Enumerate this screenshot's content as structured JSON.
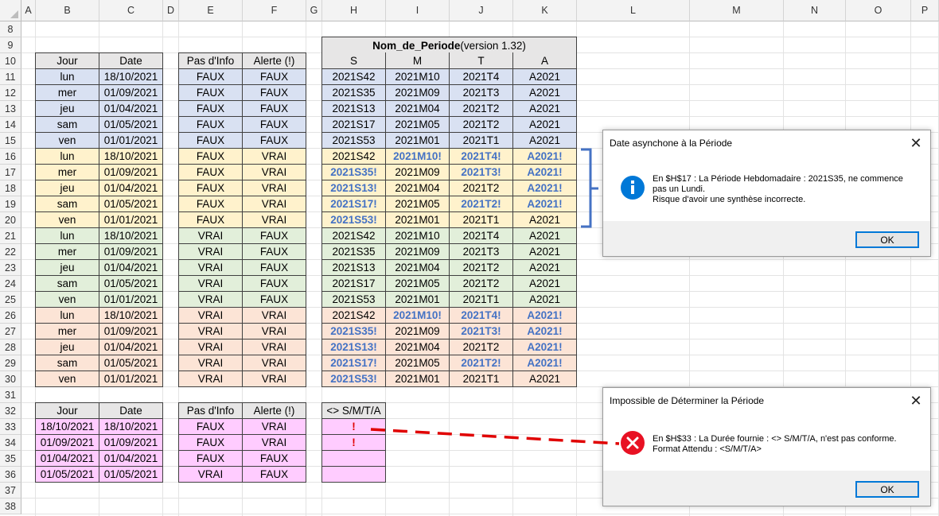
{
  "columns": [
    "A",
    "B",
    "C",
    "D",
    "E",
    "F",
    "G",
    "H",
    "I",
    "J",
    "K",
    "L",
    "M",
    "N",
    "O",
    "P"
  ],
  "rows": [
    "8",
    "9",
    "10",
    "11",
    "12",
    "13",
    "14",
    "15",
    "16",
    "17",
    "18",
    "19",
    "20",
    "21",
    "22",
    "23",
    "24",
    "25",
    "26",
    "27",
    "28",
    "29",
    "30",
    "31",
    "32",
    "33",
    "34",
    "35",
    "36",
    "37",
    "38"
  ],
  "colors": {
    "blue": "#d9e1f2",
    "yellow": "#fff2cc",
    "green": "#e2efda",
    "orange": "#fce4d6",
    "pink": "#ffccff",
    "header": "#e7e6e6",
    "accent": "#4472c4",
    "error": "#e81123"
  },
  "period_title": {
    "bold": "Nom_de_Periode",
    "rest": " (version 1.32)"
  },
  "table1": {
    "headers": {
      "jour": "Jour",
      "date": "Date",
      "pas": "Pas d'Info",
      "alerte": "Alerte (!)",
      "s": "S",
      "m": "M",
      "t": "T",
      "a": "A"
    },
    "rows": [
      {
        "jour": "lun",
        "date": "18/10/2021",
        "pas": "FAUX",
        "alerte": "FAUX",
        "s": "2021S42",
        "m": "2021M10",
        "t": "2021T4",
        "a": "A2021",
        "w": [
          0,
          0,
          0,
          0
        ],
        "fill": "blue"
      },
      {
        "jour": "mer",
        "date": "01/09/2021",
        "pas": "FAUX",
        "alerte": "FAUX",
        "s": "2021S35",
        "m": "2021M09",
        "t": "2021T3",
        "a": "A2021",
        "w": [
          0,
          0,
          0,
          0
        ],
        "fill": "blue"
      },
      {
        "jour": "jeu",
        "date": "01/04/2021",
        "pas": "FAUX",
        "alerte": "FAUX",
        "s": "2021S13",
        "m": "2021M04",
        "t": "2021T2",
        "a": "A2021",
        "w": [
          0,
          0,
          0,
          0
        ],
        "fill": "blue"
      },
      {
        "jour": "sam",
        "date": "01/05/2021",
        "pas": "FAUX",
        "alerte": "FAUX",
        "s": "2021S17",
        "m": "2021M05",
        "t": "2021T2",
        "a": "A2021",
        "w": [
          0,
          0,
          0,
          0
        ],
        "fill": "blue"
      },
      {
        "jour": "ven",
        "date": "01/01/2021",
        "pas": "FAUX",
        "alerte": "FAUX",
        "s": "2021S53",
        "m": "2021M01",
        "t": "2021T1",
        "a": "A2021",
        "w": [
          0,
          0,
          0,
          0
        ],
        "fill": "blue"
      },
      {
        "jour": "lun",
        "date": "18/10/2021",
        "pas": "FAUX",
        "alerte": "VRAI",
        "s": "2021S42",
        "m": "2021M10!",
        "t": "2021T4!",
        "a": "A2021!",
        "w": [
          0,
          1,
          1,
          1
        ],
        "fill": "yellow"
      },
      {
        "jour": "mer",
        "date": "01/09/2021",
        "pas": "FAUX",
        "alerte": "VRAI",
        "s": "2021S35!",
        "m": "2021M09",
        "t": "2021T3!",
        "a": "A2021!",
        "w": [
          1,
          0,
          1,
          1
        ],
        "fill": "yellow"
      },
      {
        "jour": "jeu",
        "date": "01/04/2021",
        "pas": "FAUX",
        "alerte": "VRAI",
        "s": "2021S13!",
        "m": "2021M04",
        "t": "2021T2",
        "a": "A2021!",
        "w": [
          1,
          0,
          0,
          1
        ],
        "fill": "yellow"
      },
      {
        "jour": "sam",
        "date": "01/05/2021",
        "pas": "FAUX",
        "alerte": "VRAI",
        "s": "2021S17!",
        "m": "2021M05",
        "t": "2021T2!",
        "a": "A2021!",
        "w": [
          1,
          0,
          1,
          1
        ],
        "fill": "yellow"
      },
      {
        "jour": "ven",
        "date": "01/01/2021",
        "pas": "FAUX",
        "alerte": "VRAI",
        "s": "2021S53!",
        "m": "2021M01",
        "t": "2021T1",
        "a": "A2021",
        "w": [
          1,
          0,
          0,
          0
        ],
        "fill": "yellow"
      },
      {
        "jour": "lun",
        "date": "18/10/2021",
        "pas": "VRAI",
        "alerte": "FAUX",
        "s": "2021S42",
        "m": "2021M10",
        "t": "2021T4",
        "a": "A2021",
        "w": [
          0,
          0,
          0,
          0
        ],
        "fill": "green"
      },
      {
        "jour": "mer",
        "date": "01/09/2021",
        "pas": "VRAI",
        "alerte": "FAUX",
        "s": "2021S35",
        "m": "2021M09",
        "t": "2021T3",
        "a": "A2021",
        "w": [
          0,
          0,
          0,
          0
        ],
        "fill": "green"
      },
      {
        "jour": "jeu",
        "date": "01/04/2021",
        "pas": "VRAI",
        "alerte": "FAUX",
        "s": "2021S13",
        "m": "2021M04",
        "t": "2021T2",
        "a": "A2021",
        "w": [
          0,
          0,
          0,
          0
        ],
        "fill": "green"
      },
      {
        "jour": "sam",
        "date": "01/05/2021",
        "pas": "VRAI",
        "alerte": "FAUX",
        "s": "2021S17",
        "m": "2021M05",
        "t": "2021T2",
        "a": "A2021",
        "w": [
          0,
          0,
          0,
          0
        ],
        "fill": "green"
      },
      {
        "jour": "ven",
        "date": "01/01/2021",
        "pas": "VRAI",
        "alerte": "FAUX",
        "s": "2021S53",
        "m": "2021M01",
        "t": "2021T1",
        "a": "A2021",
        "w": [
          0,
          0,
          0,
          0
        ],
        "fill": "green"
      },
      {
        "jour": "lun",
        "date": "18/10/2021",
        "pas": "VRAI",
        "alerte": "VRAI",
        "s": "2021S42",
        "m": "2021M10!",
        "t": "2021T4!",
        "a": "A2021!",
        "w": [
          0,
          1,
          1,
          1
        ],
        "fill": "orange"
      },
      {
        "jour": "mer",
        "date": "01/09/2021",
        "pas": "VRAI",
        "alerte": "VRAI",
        "s": "2021S35!",
        "m": "2021M09",
        "t": "2021T3!",
        "a": "A2021!",
        "w": [
          1,
          0,
          1,
          1
        ],
        "fill": "orange"
      },
      {
        "jour": "jeu",
        "date": "01/04/2021",
        "pas": "VRAI",
        "alerte": "VRAI",
        "s": "2021S13!",
        "m": "2021M04",
        "t": "2021T2",
        "a": "A2021!",
        "w": [
          1,
          0,
          0,
          1
        ],
        "fill": "orange"
      },
      {
        "jour": "sam",
        "date": "01/05/2021",
        "pas": "VRAI",
        "alerte": "VRAI",
        "s": "2021S17!",
        "m": "2021M05",
        "t": "2021T2!",
        "a": "A2021!",
        "w": [
          1,
          0,
          1,
          1
        ],
        "fill": "orange"
      },
      {
        "jour": "ven",
        "date": "01/01/2021",
        "pas": "VRAI",
        "alerte": "VRAI",
        "s": "2021S53!",
        "m": "2021M01",
        "t": "2021T1",
        "a": "A2021",
        "w": [
          1,
          0,
          0,
          0
        ],
        "fill": "orange"
      }
    ]
  },
  "table2": {
    "headers": {
      "jour": "Jour",
      "date": "Date",
      "pas": "Pas d'Info",
      "alerte": "Alerte (!)",
      "dur": "<> S/M/T/A"
    },
    "rows": [
      {
        "jour": "18/10/2021",
        "date": "18/10/2021",
        "pas": "FAUX",
        "alerte": "VRAI",
        "dur": "!"
      },
      {
        "jour": "01/09/2021",
        "date": "01/09/2021",
        "pas": "FAUX",
        "alerte": "VRAI",
        "dur": "!"
      },
      {
        "jour": "01/04/2021",
        "date": "01/04/2021",
        "pas": "FAUX",
        "alerte": "FAUX",
        "dur": ""
      },
      {
        "jour": "01/05/2021",
        "date": "01/05/2021",
        "pas": "VRAI",
        "alerte": "FAUX",
        "dur": ""
      }
    ]
  },
  "dialog_info": {
    "title": "Date asynchone à la Période",
    "line1": "En $H$17 : La Période Hebdomadaire : 2021S35, ne commence",
    "line2": "pas un Lundi.",
    "line3": "Risque d'avoir une synthèse incorrecte.",
    "ok": "OK",
    "close": "✕",
    "icon": "info-icon"
  },
  "dialog_error": {
    "title": "Impossible de Déterminer la Période",
    "line1": "En $H$33 : La Durée fournie : <> S/M/T/A, n'est pas conforme.",
    "line2": "Format Attendu : <S/M/T/A>",
    "ok": "OK",
    "close": "✕",
    "icon": "error-icon"
  }
}
